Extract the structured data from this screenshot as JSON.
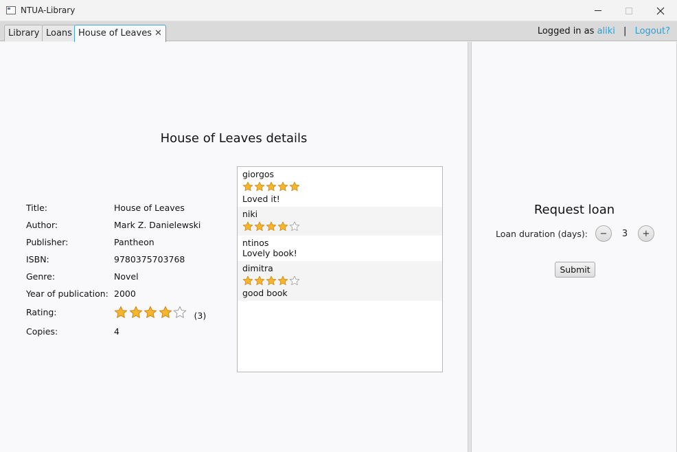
{
  "window": {
    "title": "NTUA-Library",
    "minimize_icon": "minimize-icon",
    "maximize_icon": "maximize-icon",
    "close_icon": "close-icon"
  },
  "tabs": [
    {
      "label": "Library",
      "active": false
    },
    {
      "label": "Loans",
      "active": false
    },
    {
      "label": "House of Leaves",
      "active": true,
      "close": "✕"
    }
  ],
  "session": {
    "prefix": "Logged in as",
    "username": "aliki",
    "separator": "|",
    "logout": "Logout?"
  },
  "details": {
    "heading": "House of Leaves details",
    "fields": [
      {
        "label": "Title:",
        "value": "House of Leaves"
      },
      {
        "label": "Author:",
        "value": "Mark Z. Danielewski"
      },
      {
        "label": "Publisher:",
        "value": "Pantheon"
      },
      {
        "label": "ISBN:",
        "value": "9780375703768"
      },
      {
        "label": "Genre:",
        "value": "Novel"
      },
      {
        "label": "Year of publication:",
        "value": "2000"
      }
    ],
    "rating": {
      "label": "Rating:",
      "stars": 4,
      "max": 5,
      "count": "(3)"
    },
    "copies": {
      "label": "Copies:",
      "value": "4"
    }
  },
  "reviews": [
    {
      "user": "giorgos",
      "stars": 5,
      "comment": "Loved it!"
    },
    {
      "user": "niki",
      "stars": 4,
      "comment": ""
    },
    {
      "user": "ntinos",
      "stars": 0,
      "comment": "Lovely book!"
    },
    {
      "user": "dimitra",
      "stars": 4,
      "comment": "good book"
    }
  ],
  "loan": {
    "heading": "Request loan",
    "duration_label": "Loan duration (days):",
    "decrement": "−",
    "increment": "+",
    "value": "3",
    "submit": "Submit"
  },
  "colors": {
    "accent": "#2aa0d8",
    "star_fill": "#f7b52c",
    "star_empty": "#ffffff"
  }
}
